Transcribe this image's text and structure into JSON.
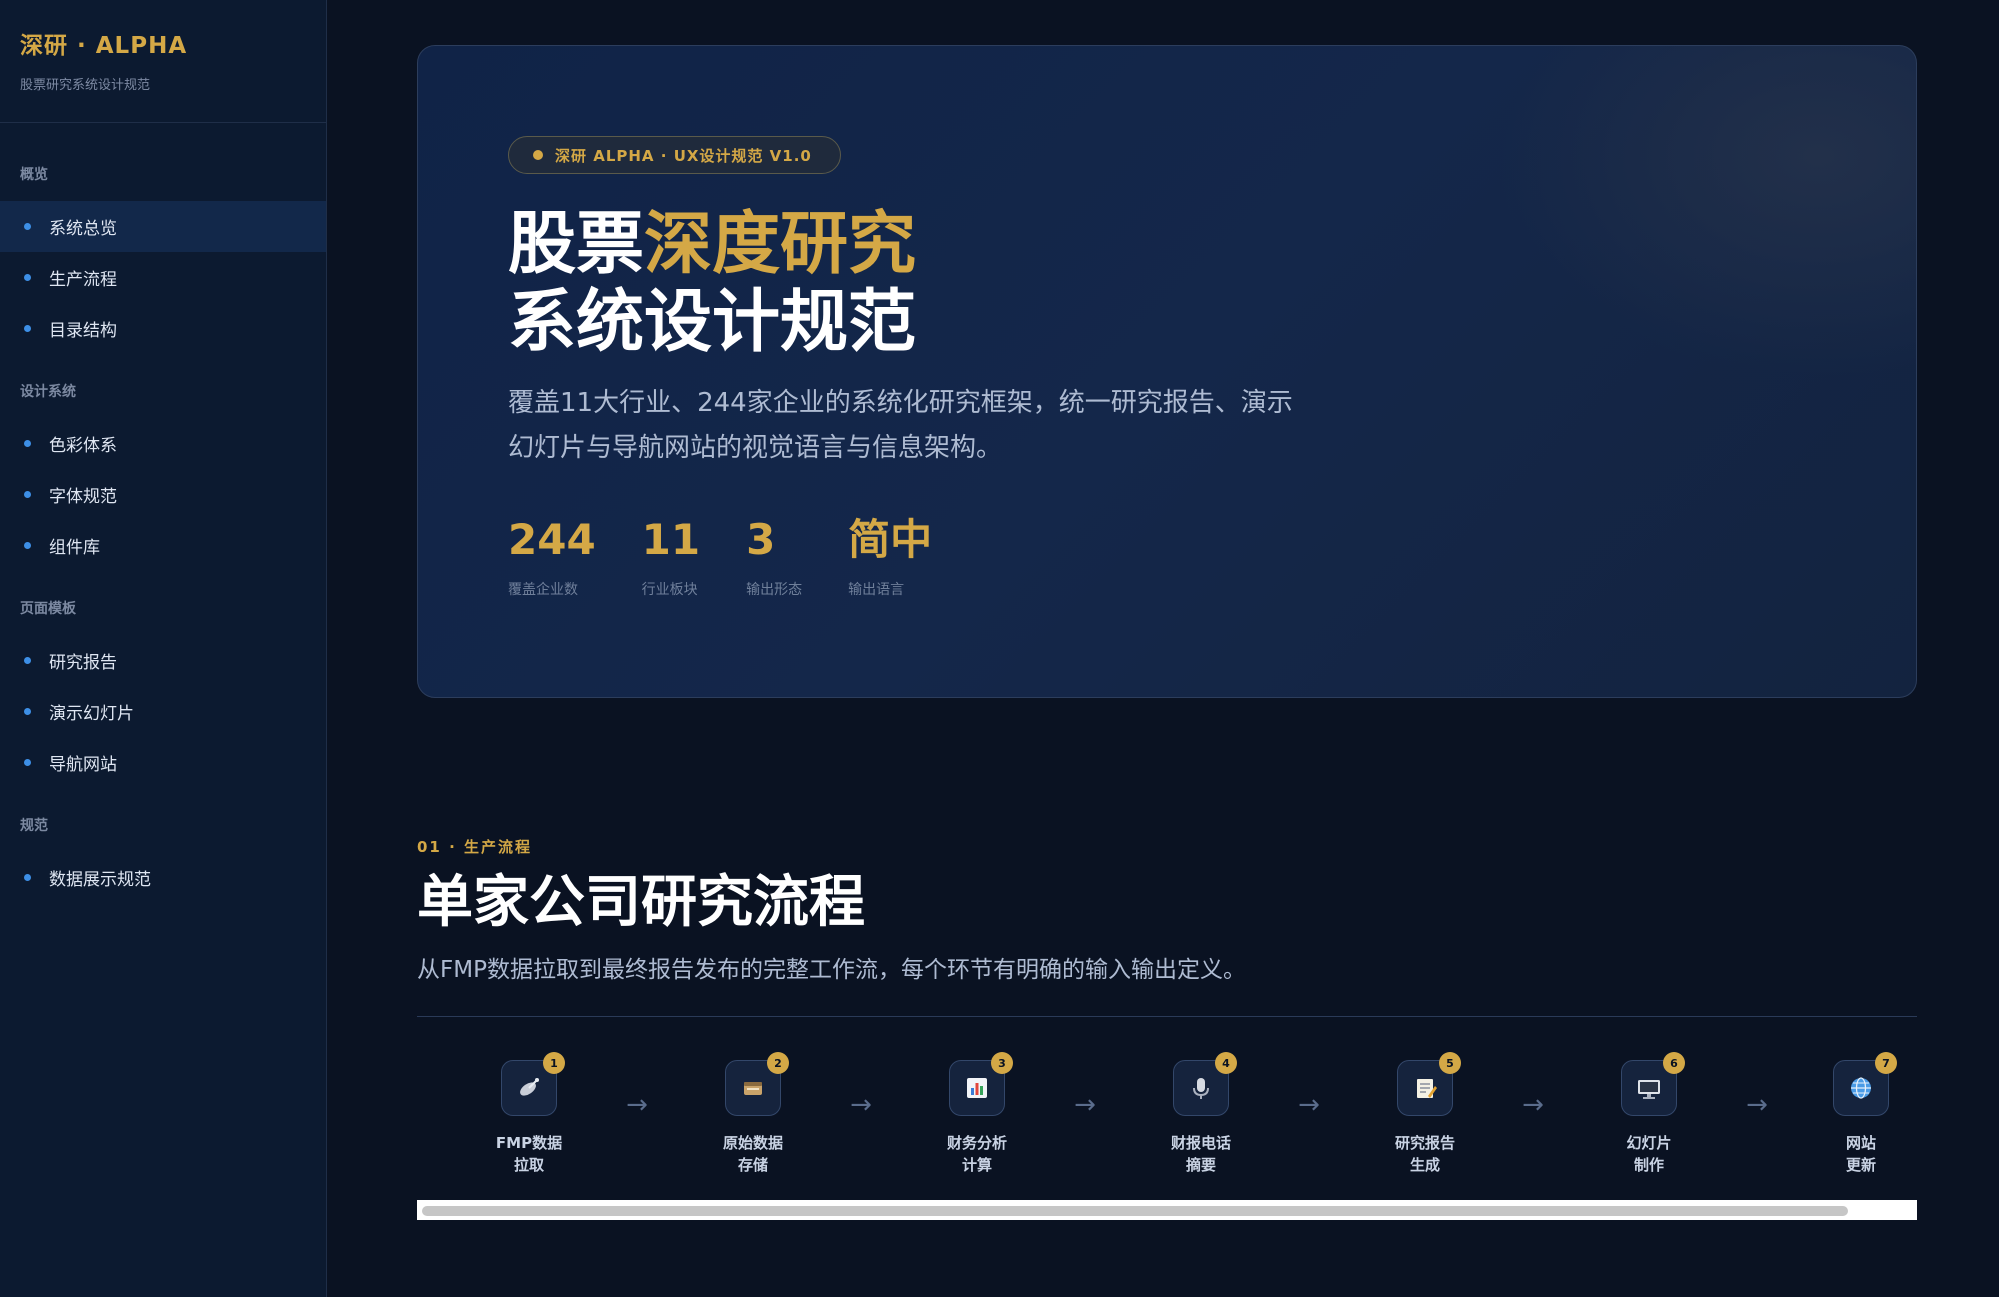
{
  "brand": {
    "title": "深研 · ALPHA",
    "subtitle": "股票研究系统设计规范"
  },
  "nav": {
    "groups": [
      {
        "label": "概览",
        "items": [
          "系统总览",
          "生产流程",
          "目录结构"
        ]
      },
      {
        "label": "设计系统",
        "items": [
          "色彩体系",
          "字体规范",
          "组件库"
        ]
      },
      {
        "label": "页面模板",
        "items": [
          "研究报告",
          "演示幻灯片",
          "导航网站"
        ]
      },
      {
        "label": "规范",
        "items": [
          "数据展示规范"
        ]
      }
    ],
    "active": "系统总览"
  },
  "hero": {
    "pill": "深研 ALPHA · UX设计规范 V1.0",
    "title_line1_plain": "股票",
    "title_line1_accent": "深度研究",
    "title_line2": "系统设计规范",
    "desc_line1": "覆盖11大行业、244家企业的系统化研究框架，统一研究报告、演示",
    "desc_line2": "幻灯片与导航网站的视觉语言与信息架构。",
    "stats": [
      {
        "value": "244",
        "label": "覆盖企业数"
      },
      {
        "value": "11",
        "label": "行业板块"
      },
      {
        "value": "3",
        "label": "输出形态"
      },
      {
        "value": "简中",
        "label": "输出语言"
      }
    ]
  },
  "section": {
    "eyebrow": "01 · 生产流程",
    "title": "单家公司研究流程",
    "desc": "从FMP数据拉取到最终报告发布的完整工作流，每个环节有明确的输入输出定义。"
  },
  "flow": {
    "arrow": "→",
    "steps": [
      {
        "num": "1",
        "line1": "FMP数据",
        "line2": "拉取",
        "icon": "satellite-icon"
      },
      {
        "num": "2",
        "line1": "原始数据",
        "line2": "存储",
        "icon": "card-file-icon"
      },
      {
        "num": "3",
        "line1": "财务分析",
        "line2": "计算",
        "icon": "bar-chart-icon"
      },
      {
        "num": "4",
        "line1": "财报电话",
        "line2": "摘要",
        "icon": "microphone-icon"
      },
      {
        "num": "5",
        "line1": "研究报告",
        "line2": "生成",
        "icon": "memo-icon"
      },
      {
        "num": "6",
        "line1": "幻灯片",
        "line2": "制作",
        "icon": "monitor-icon"
      },
      {
        "num": "7",
        "line1": "网站",
        "line2": "更新",
        "icon": "globe-icon"
      }
    ]
  },
  "colors": {
    "accent": "#d4a846",
    "nav_dot": "#3d8fe6",
    "bg": "#0a1222"
  }
}
